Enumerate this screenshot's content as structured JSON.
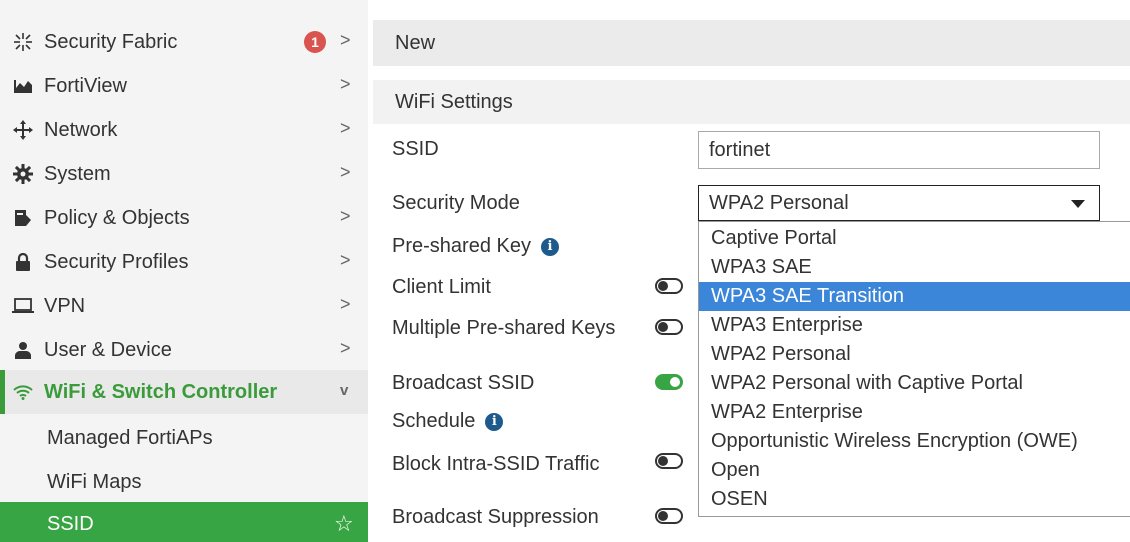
{
  "sidebar": {
    "items": [
      {
        "label": "Security Fabric",
        "icon": "fabric-icon",
        "badge": "1",
        "chevron": ">"
      },
      {
        "label": "FortiView",
        "icon": "chart-icon",
        "chevron": ">"
      },
      {
        "label": "Network",
        "icon": "network-move-icon",
        "chevron": ">"
      },
      {
        "label": "System",
        "icon": "gear-icon",
        "chevron": ">"
      },
      {
        "label": "Policy & Objects",
        "icon": "policy-icon",
        "chevron": ">"
      },
      {
        "label": "Security Profiles",
        "icon": "lock-icon",
        "chevron": ">"
      },
      {
        "label": "VPN",
        "icon": "laptop-icon",
        "chevron": ">"
      },
      {
        "label": "User & Device",
        "icon": "user-icon",
        "chevron": ">"
      },
      {
        "label": "WiFi & Switch Controller",
        "icon": "wifi-icon",
        "chevron": "v",
        "active": true
      }
    ],
    "subitems": [
      {
        "label": "Managed FortiAPs"
      },
      {
        "label": "WiFi Maps"
      },
      {
        "label": "SSID",
        "selected": true,
        "star": "☆"
      }
    ]
  },
  "main": {
    "header": "New",
    "section_title": "WiFi Settings",
    "fields": {
      "ssid_label": "SSID",
      "ssid_value": "fortinet",
      "security_mode_label": "Security Mode",
      "security_mode_value": "WPA2 Personal",
      "preshared_key_label": "Pre-shared Key",
      "client_limit_label": "Client Limit",
      "multi_psk_label": "Multiple Pre-shared Keys",
      "broadcast_ssid_label": "Broadcast SSID",
      "schedule_label": "Schedule",
      "block_intra_label": "Block Intra-SSID Traffic",
      "broadcast_suppression_label": "Broadcast Suppression"
    },
    "toggles": {
      "client_limit": false,
      "multi_psk": false,
      "broadcast_ssid": true,
      "block_intra": false,
      "broadcast_suppression": false
    },
    "dropdown_options": [
      "Captive Portal",
      "WPA3 SAE",
      "WPA3 SAE Transition",
      "WPA3 Enterprise",
      "WPA2 Personal",
      "WPA2 Personal with Captive Portal",
      "WPA2 Enterprise",
      "Opportunistic Wireless Encryption (OWE)",
      "Open",
      "OSEN"
    ],
    "highlighted_option": "WPA3 SAE Transition",
    "info_glyph": "i"
  },
  "colors": {
    "accent_green": "#38a544",
    "highlight_blue": "#3b86d9",
    "badge_red": "#d9534f",
    "info_blue": "#1f5a8c"
  }
}
